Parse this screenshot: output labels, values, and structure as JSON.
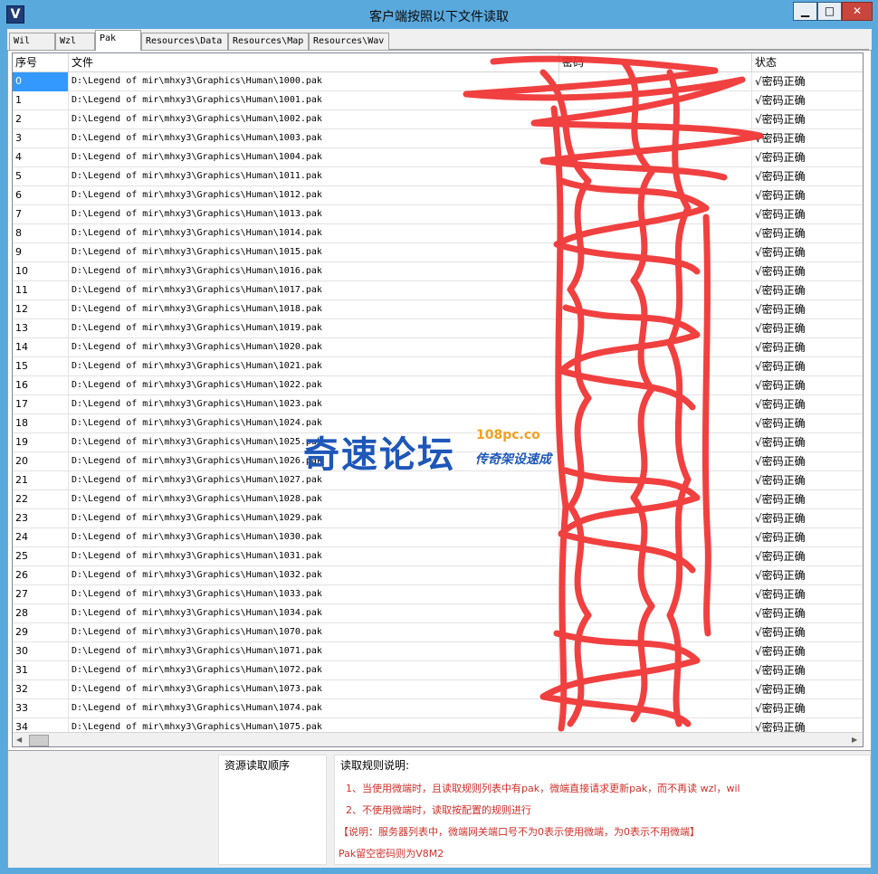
{
  "window": {
    "title": "客户端按照以下文件读取",
    "app_icon_glyph": "V",
    "minimize_glyph": "▁",
    "maximize_glyph": "□",
    "close_glyph": "✕"
  },
  "tabs": [
    {
      "label": "Wil",
      "active": false
    },
    {
      "label": "Wzl",
      "active": false
    },
    {
      "label": "Pak",
      "active": true
    },
    {
      "label": "Resources\\Data",
      "active": false
    },
    {
      "label": "Resources\\Map",
      "active": false
    },
    {
      "label": "Resources\\Wav",
      "active": false
    }
  ],
  "list": {
    "columns": [
      "序号",
      "文件",
      "密码",
      "状态"
    ],
    "rows": [
      {
        "idx": "0",
        "file": "D:\\Legend of mir\\mhxy3\\Graphics\\Human\\1000.pak",
        "status": "√密码正确"
      },
      {
        "idx": "1",
        "file": "D:\\Legend of mir\\mhxy3\\Graphics\\Human\\1001.pak",
        "status": "√密码正确"
      },
      {
        "idx": "2",
        "file": "D:\\Legend of mir\\mhxy3\\Graphics\\Human\\1002.pak",
        "status": "√密码正确"
      },
      {
        "idx": "3",
        "file": "D:\\Legend of mir\\mhxy3\\Graphics\\Human\\1003.pak",
        "status": "√密码正确"
      },
      {
        "idx": "4",
        "file": "D:\\Legend of mir\\mhxy3\\Graphics\\Human\\1004.pak",
        "status": "√密码正确"
      },
      {
        "idx": "5",
        "file": "D:\\Legend of mir\\mhxy3\\Graphics\\Human\\1011.pak",
        "status": "√密码正确"
      },
      {
        "idx": "6",
        "file": "D:\\Legend of mir\\mhxy3\\Graphics\\Human\\1012.pak",
        "status": "√密码正确"
      },
      {
        "idx": "7",
        "file": "D:\\Legend of mir\\mhxy3\\Graphics\\Human\\1013.pak",
        "status": "√密码正确"
      },
      {
        "idx": "8",
        "file": "D:\\Legend of mir\\mhxy3\\Graphics\\Human\\1014.pak",
        "status": "√密码正确"
      },
      {
        "idx": "9",
        "file": "D:\\Legend of mir\\mhxy3\\Graphics\\Human\\1015.pak",
        "status": "√密码正确"
      },
      {
        "idx": "10",
        "file": "D:\\Legend of mir\\mhxy3\\Graphics\\Human\\1016.pak",
        "status": "√密码正确"
      },
      {
        "idx": "11",
        "file": "D:\\Legend of mir\\mhxy3\\Graphics\\Human\\1017.pak",
        "status": "√密码正确"
      },
      {
        "idx": "12",
        "file": "D:\\Legend of mir\\mhxy3\\Graphics\\Human\\1018.pak",
        "status": "√密码正确"
      },
      {
        "idx": "13",
        "file": "D:\\Legend of mir\\mhxy3\\Graphics\\Human\\1019.pak",
        "status": "√密码正确"
      },
      {
        "idx": "14",
        "file": "D:\\Legend of mir\\mhxy3\\Graphics\\Human\\1020.pak",
        "status": "√密码正确"
      },
      {
        "idx": "15",
        "file": "D:\\Legend of mir\\mhxy3\\Graphics\\Human\\1021.pak",
        "status": "√密码正确"
      },
      {
        "idx": "16",
        "file": "D:\\Legend of mir\\mhxy3\\Graphics\\Human\\1022.pak",
        "status": "√密码正确"
      },
      {
        "idx": "17",
        "file": "D:\\Legend of mir\\mhxy3\\Graphics\\Human\\1023.pak",
        "status": "√密码正确"
      },
      {
        "idx": "18",
        "file": "D:\\Legend of mir\\mhxy3\\Graphics\\Human\\1024.pak",
        "status": "√密码正确"
      },
      {
        "idx": "19",
        "file": "D:\\Legend of mir\\mhxy3\\Graphics\\Human\\1025.pak",
        "status": "√密码正确"
      },
      {
        "idx": "20",
        "file": "D:\\Legend of mir\\mhxy3\\Graphics\\Human\\1026.pak",
        "status": "√密码正确"
      },
      {
        "idx": "21",
        "file": "D:\\Legend of mir\\mhxy3\\Graphics\\Human\\1027.pak",
        "status": "√密码正确"
      },
      {
        "idx": "22",
        "file": "D:\\Legend of mir\\mhxy3\\Graphics\\Human\\1028.pak",
        "status": "√密码正确"
      },
      {
        "idx": "23",
        "file": "D:\\Legend of mir\\mhxy3\\Graphics\\Human\\1029.pak",
        "status": "√密码正确"
      },
      {
        "idx": "24",
        "file": "D:\\Legend of mir\\mhxy3\\Graphics\\Human\\1030.pak",
        "status": "√密码正确"
      },
      {
        "idx": "25",
        "file": "D:\\Legend of mir\\mhxy3\\Graphics\\Human\\1031.pak",
        "status": "√密码正确"
      },
      {
        "idx": "26",
        "file": "D:\\Legend of mir\\mhxy3\\Graphics\\Human\\1032.pak",
        "status": "√密码正确"
      },
      {
        "idx": "27",
        "file": "D:\\Legend of mir\\mhxy3\\Graphics\\Human\\1033.pak",
        "status": "√密码正确"
      },
      {
        "idx": "28",
        "file": "D:\\Legend of mir\\mhxy3\\Graphics\\Human\\1034.pak",
        "status": "√密码正确"
      },
      {
        "idx": "29",
        "file": "D:\\Legend of mir\\mhxy3\\Graphics\\Human\\1070.pak",
        "status": "√密码正确"
      },
      {
        "idx": "30",
        "file": "D:\\Legend of mir\\mhxy3\\Graphics\\Human\\1071.pak",
        "status": "√密码正确"
      },
      {
        "idx": "31",
        "file": "D:\\Legend of mir\\mhxy3\\Graphics\\Human\\1072.pak",
        "status": "√密码正确"
      },
      {
        "idx": "32",
        "file": "D:\\Legend of mir\\mhxy3\\Graphics\\Human\\1073.pak",
        "status": "√密码正确"
      },
      {
        "idx": "33",
        "file": "D:\\Legend of mir\\mhxy3\\Graphics\\Human\\1074.pak",
        "status": "√密码正确"
      },
      {
        "idx": "34",
        "file": "D:\\Legend of mir\\mhxy3\\Graphics\\Human\\1075.pak",
        "status": "√密码正确"
      }
    ]
  },
  "scroll": {
    "up_glyph": "▲",
    "down_glyph": "▼",
    "left_glyph": "◀",
    "right_glyph": "▶"
  },
  "lower": {
    "order_label": "资源读取顺序",
    "rules_title": "读取规则说明:",
    "rule1": "1、当使用微端时，且读取规则列表中有pak，微端直接请求更新pak，而不再读 wzl，wil",
    "rule2": "2、不使用微端时，读取按配置的规则进行",
    "note": "【说明：服务器列表中，微端网关端口号不为0表示使用微端，为0表示不用微端】",
    "pak_note": "Pak留空密码则为V8M2"
  },
  "watermark": {
    "main": "奇速论坛",
    "url": "108pc.co",
    "sub": "传奇架设速成"
  },
  "colors": {
    "title_bg": "#5aa9dd",
    "selection": "#3399ff",
    "rule_text": "#d0302a",
    "scribble": "#f03030",
    "watermark": "#1e57b8"
  }
}
